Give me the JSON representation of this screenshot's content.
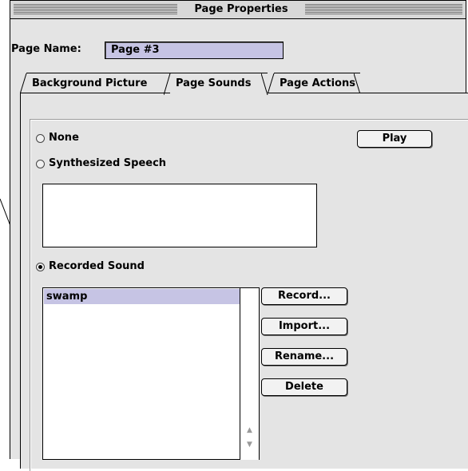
{
  "window": {
    "title": "Page Properties"
  },
  "page_name": {
    "label": "Page Name:",
    "value": "Page #3"
  },
  "tabs": [
    {
      "label": "Background Picture",
      "active": false
    },
    {
      "label": "Page Sounds",
      "active": true
    },
    {
      "label": "Page Actions",
      "active": false
    }
  ],
  "sound_options": {
    "none": {
      "label": "None",
      "selected": false
    },
    "synth": {
      "label": "Synthesized Speech",
      "selected": false
    },
    "recorded": {
      "label": "Recorded Sound",
      "selected": true
    }
  },
  "play_button": "Play",
  "speech_text": "",
  "sounds_list": {
    "items": [
      "swamp"
    ],
    "selected_index": 0
  },
  "buttons": {
    "record": "Record...",
    "import": "Import...",
    "rename": "Rename...",
    "delete": "Delete"
  },
  "icons": {
    "scroll_up": "scroll-up-arrow-icon",
    "scroll_down": "scroll-down-arrow-icon"
  },
  "colors": {
    "selection": "#c6c4e4",
    "window_bg": "#e4e4e4"
  }
}
